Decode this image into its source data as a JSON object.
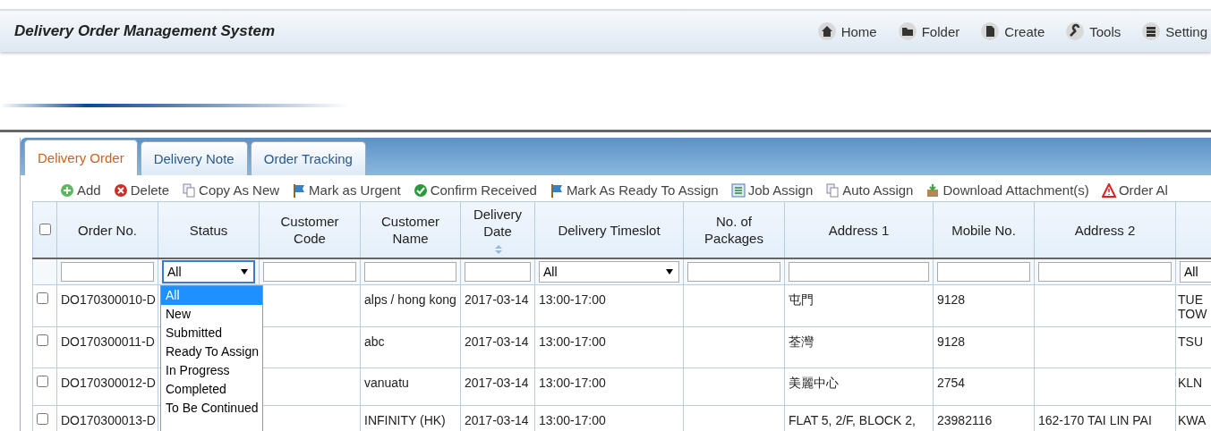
{
  "app_title": "Delivery Order Management System",
  "nav": [
    {
      "label": "Home",
      "kind": "home"
    },
    {
      "label": "Folder",
      "kind": "folder"
    },
    {
      "label": "Create",
      "kind": "create"
    },
    {
      "label": "Tools",
      "kind": "tools"
    },
    {
      "label": "Setting",
      "kind": "setting"
    }
  ],
  "tabs": [
    {
      "label": "Delivery Order",
      "selected": true
    },
    {
      "label": "Delivery Note",
      "selected": false
    },
    {
      "label": "Order Tracking",
      "selected": false
    }
  ],
  "toolbar": [
    {
      "label": "Add",
      "kind": "add"
    },
    {
      "label": "Delete",
      "kind": "delete"
    },
    {
      "label": "Copy As New",
      "kind": "copy"
    },
    {
      "label": "Mark as Urgent",
      "kind": "flag"
    },
    {
      "label": "Confirm Received",
      "kind": "confirm"
    },
    {
      "label": "Mark As Ready To Assign",
      "kind": "flag"
    },
    {
      "label": "Job Assign",
      "kind": "job"
    },
    {
      "label": "Auto Assign",
      "kind": "copy"
    },
    {
      "label": "Download Attachment(s)",
      "kind": "download"
    },
    {
      "label": "Order Al",
      "kind": "warning"
    }
  ],
  "table": {
    "select_all_checked": false,
    "columns": [
      {
        "label": "Order No.",
        "sortable": false
      },
      {
        "label": "Status",
        "sortable": false
      },
      {
        "label": "Customer Code",
        "sortable": false
      },
      {
        "label": "Customer Name",
        "sortable": false
      },
      {
        "label": "Delivery Date",
        "sortable": true
      },
      {
        "label": "Delivery Timeslot",
        "sortable": false
      },
      {
        "label": "No. of Packages",
        "sortable": false
      },
      {
        "label": "Address 1",
        "sortable": false
      },
      {
        "label": "Mobile No.",
        "sortable": false
      },
      {
        "label": "Address 2",
        "sortable": false
      },
      {
        "sortable": false
      }
    ],
    "filters": [
      {
        "kind": "text"
      },
      {
        "kind": "select",
        "value": "All"
      },
      {
        "kind": "text"
      },
      {
        "kind": "text"
      },
      {
        "kind": "text"
      },
      {
        "kind": "select",
        "value": "All"
      },
      {
        "kind": "text"
      },
      {
        "kind": "text"
      },
      {
        "kind": "text"
      },
      {
        "kind": "text"
      },
      {
        "kind": "select",
        "value": "All"
      }
    ],
    "rows": [
      {
        "checked": false,
        "order_no": "DO170300010-D",
        "customer_name": "alps / hong kong",
        "delivery_date": "2017-03-14",
        "timeslot": "13:00-17:00",
        "address_1": "屯門",
        "mobile_no": "9128",
        "column_11": "TUE TOW"
      },
      {
        "checked": false,
        "order_no": "DO170300011-D",
        "customer_name": "abc",
        "delivery_date": "2017-03-14",
        "timeslot": "13:00-17:00",
        "address_1": "荃灣",
        "mobile_no": "9128",
        "column_11": "TSU"
      },
      {
        "checked": false,
        "order_no": "DO170300012-D",
        "customer_name": "vanuatu",
        "delivery_date": "2017-03-14",
        "timeslot": "13:00-17:00",
        "address_1": "美麗中心",
        "mobile_no": "2754",
        "column_11": "KLN"
      },
      {
        "checked": false,
        "order_no": "DO170300013-D",
        "customer_name": "INFINITY (HK)",
        "delivery_date": "2017-03-14",
        "timeslot": "13:00-17:00",
        "address_1": "FLAT 5, 2/F, BLOCK 2,",
        "mobile_no": "23982116",
        "address_2": "162-170 TAI LIN PAI",
        "column_11": "KWA"
      }
    ],
    "status_dropdown": {
      "options": [
        {
          "label": "All",
          "selected": true
        },
        {
          "label": "New",
          "selected": false
        },
        {
          "label": "Submitted",
          "selected": false
        },
        {
          "label": "Ready To Assign",
          "selected": false
        },
        {
          "label": "In Progress",
          "selected": false
        },
        {
          "label": "Completed",
          "selected": false
        },
        {
          "label": "To Be Continued",
          "selected": false
        }
      ]
    }
  }
}
